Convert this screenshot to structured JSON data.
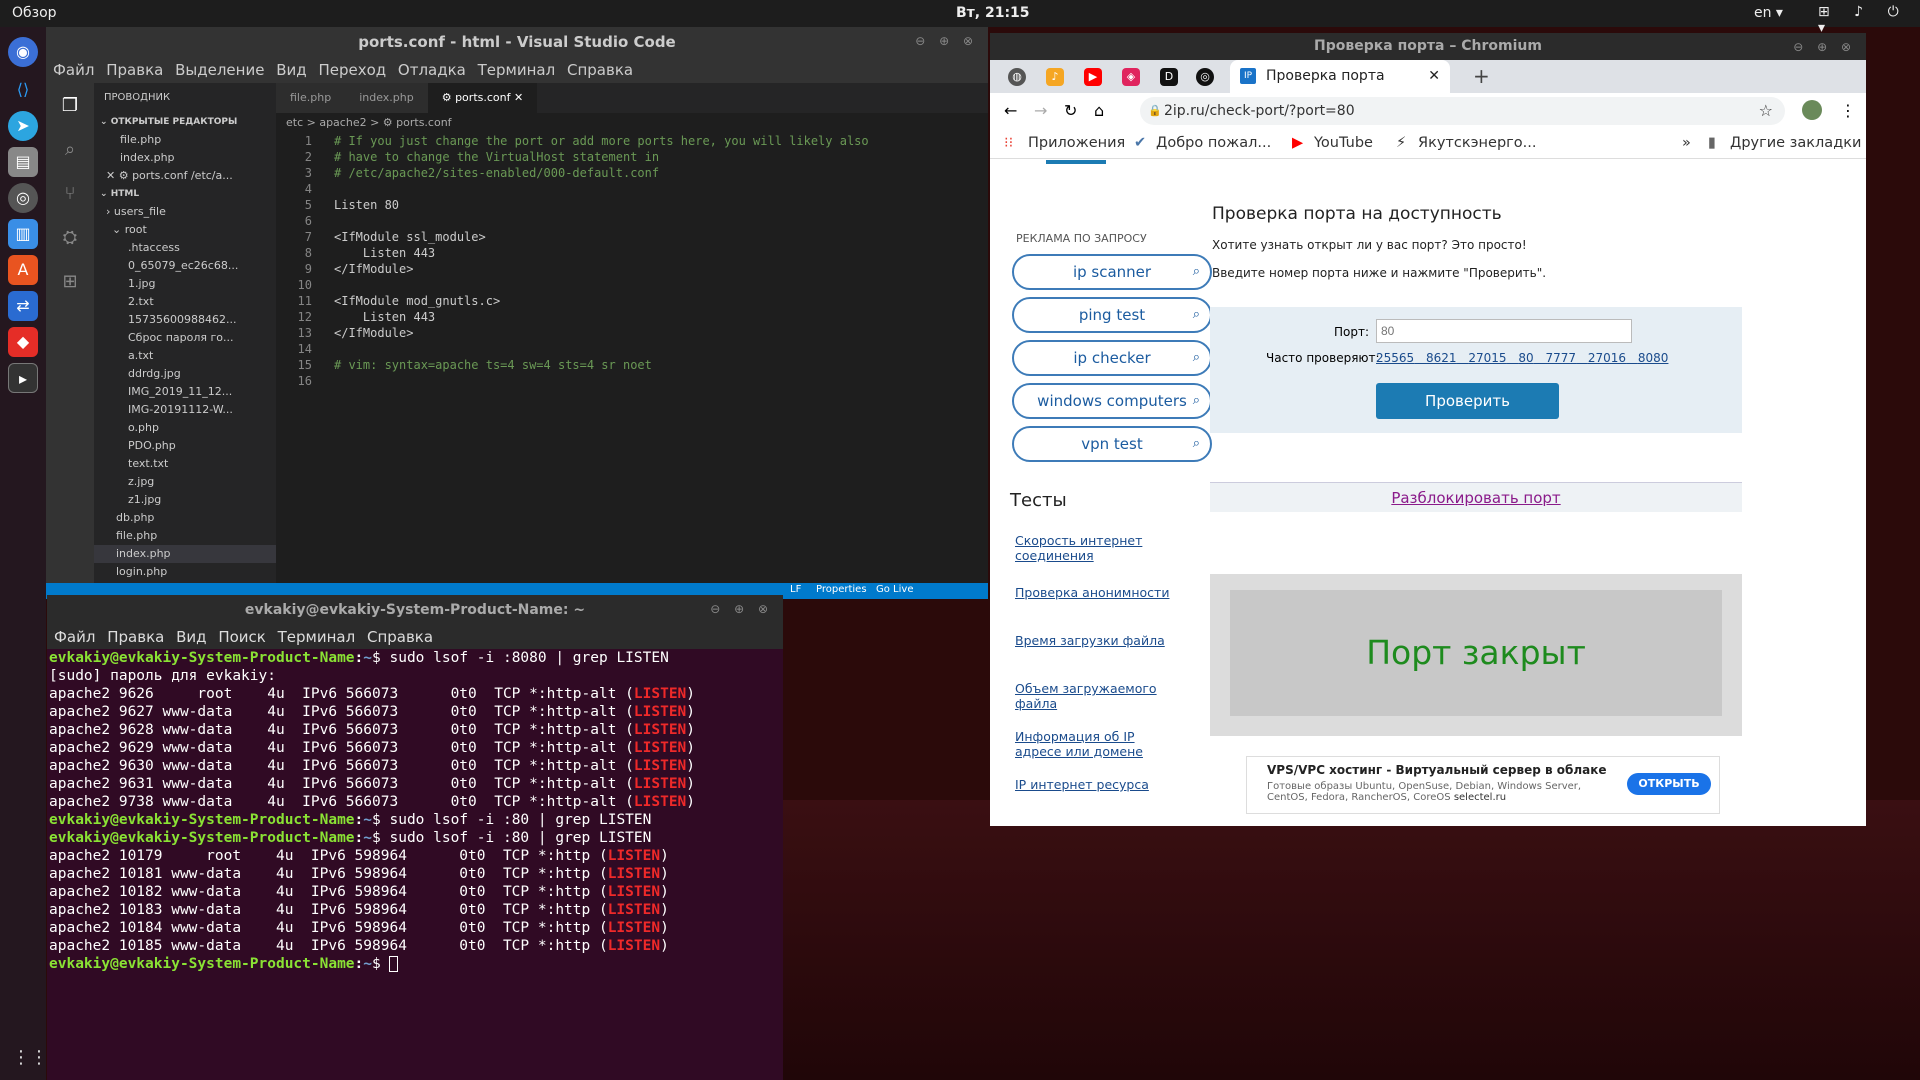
{
  "topbar": {
    "activities": "Обзор",
    "clock": "Вт, 21:15",
    "lang": "en ▾",
    "tray": "⊞ ♪ ⏻ ▾"
  },
  "vscode": {
    "title": "ports.conf - html - Visual Studio Code",
    "menu": [
      "Файл",
      "Правка",
      "Выделение",
      "Вид",
      "Переход",
      "Отладка",
      "Терминал",
      "Справка"
    ],
    "explorer_title": "ПРОВОДНИК",
    "open_editors": "ОТКРЫТЫЕ РЕДАКТОРЫ",
    "open_files": [
      "file.php",
      "index.php",
      "ports.conf  /etc/a..."
    ],
    "html_section": "HTML",
    "tree": [
      "users_file",
      "root",
      ".htaccess",
      "0_65079_ec26c68...",
      "1.jpg",
      "2.txt",
      "15735600988462...",
      "Сброс пароля го...",
      "a.txt",
      "ddrdg.jpg",
      "IMG_2019_11_12...",
      "IMG-20191112-W...",
      "o.php",
      "PDO.php",
      "text.txt",
      "z.jpg",
      "z1.jpg",
      "db.php",
      "file.php",
      "index.php",
      "login.php"
    ],
    "tabs": [
      "file.php",
      "index.php",
      "ports.conf"
    ],
    "breadcrumb": "etc > apache2 > ⚙ ports.conf",
    "code": [
      "# If you just change the port or add more ports here, you will likely also",
      "# have to change the VirtualHost statement in",
      "# /etc/apache2/sites-enabled/000-default.conf",
      "",
      "Listen 80",
      "",
      "<IfModule ssl_module>",
      "    Listen 443",
      "</IfModule>",
      "",
      "<IfModule mod_gnutls.c>",
      "    Listen 443",
      "</IfModule>",
      "",
      "# vim: syntax=apache ts=4 sw=4 sts=4 sr noet",
      ""
    ],
    "status": {
      "lf": "LF",
      "props": "Properties",
      "golive": "Go Live"
    }
  },
  "terminal": {
    "title": "evkakiy@evkakiy-System-Product-Name: ~",
    "menu": [
      "Файл",
      "Правка",
      "Вид",
      "Поиск",
      "Терминал",
      "Справка"
    ],
    "prompt_user": "evkakiy@evkakiy-System-Product-Name",
    "prompt_path": "~",
    "cmd1": "sudo lsof -i :8080 | grep LISTEN",
    "sudo": "[sudo] пароль для evkakiy:",
    "block1": [
      "apache2 9626     root    4u  IPv6 566073      0t0  TCP *:http-alt (",
      "apache2 9627 www-data    4u  IPv6 566073      0t0  TCP *:http-alt (",
      "apache2 9628 www-data    4u  IPv6 566073      0t0  TCP *:http-alt (",
      "apache2 9629 www-data    4u  IPv6 566073      0t0  TCP *:http-alt (",
      "apache2 9630 www-data    4u  IPv6 566073      0t0  TCP *:http-alt (",
      "apache2 9631 www-data    4u  IPv6 566073      0t0  TCP *:http-alt (",
      "apache2 9738 www-data    4u  IPv6 566073      0t0  TCP *:http-alt ("
    ],
    "cmd2": "sudo lsof -i :80 | grep LISTEN",
    "block2": [
      "apache2 10179     root    4u  IPv6 598964      0t0  TCP *:http (",
      "apache2 10181 www-data    4u  IPv6 598964      0t0  TCP *:http (",
      "apache2 10182 www-data    4u  IPv6 598964      0t0  TCP *:http (",
      "apache2 10183 www-data    4u  IPv6 598964      0t0  TCP *:http (",
      "apache2 10184 www-data    4u  IPv6 598964      0t0  TCP *:http (",
      "apache2 10185 www-data    4u  IPv6 598964      0t0  TCP *:http ("
    ],
    "listen": "LISTEN"
  },
  "chromium": {
    "title": "Проверка порта – Chromium",
    "tab": "Проверка порта",
    "url": "2ip.ru/check-port/?port=80",
    "bookmarks": [
      "Приложения",
      "Добро пожал...",
      "YouTube",
      "Якутскэнерго...",
      "Другие закладки"
    ],
    "page": {
      "ad_label": "РЕКЛАМА ПО ЗАПРОСУ",
      "ad_buttons": [
        "ip scanner",
        "ping test",
        "ip checker",
        "windows computers",
        "vpn test"
      ],
      "heading": "Проверка порта на доступность",
      "sub1": "Хотите узнать открыт ли у вас порт? Это просто!",
      "sub2": "Введите номер порта ниже и нажмите \"Проверить\".",
      "port_label": "Порт:",
      "port_placeholder": "80",
      "often_label": "Часто проверяют:",
      "often_ports": [
        "25565",
        "8621",
        "27015",
        "80",
        "7777",
        "27016",
        "8080"
      ],
      "check_button": "Проверить",
      "unblock": "Разблокировать порт",
      "result": "Порт закрыт",
      "tests_title": "Тесты",
      "tests": [
        "Скорость интернет соединения",
        "Проверка анонимности",
        "Время загрузки файла",
        "Объем загружаемого файла",
        "Информация об IP адресе или домене",
        "IP интернет ресурса"
      ],
      "ad_title": "VPS/VPC хостинг - Виртуальный сервер в облаке",
      "ad_text": "Готовые образы Ubuntu, OpenSuse, Debian, Windows Server, CentOS, Fedora, RancherOS, CoreOS",
      "ad_domain": "selectel.ru",
      "ad_button": "ОТКРЫТЬ"
    }
  }
}
